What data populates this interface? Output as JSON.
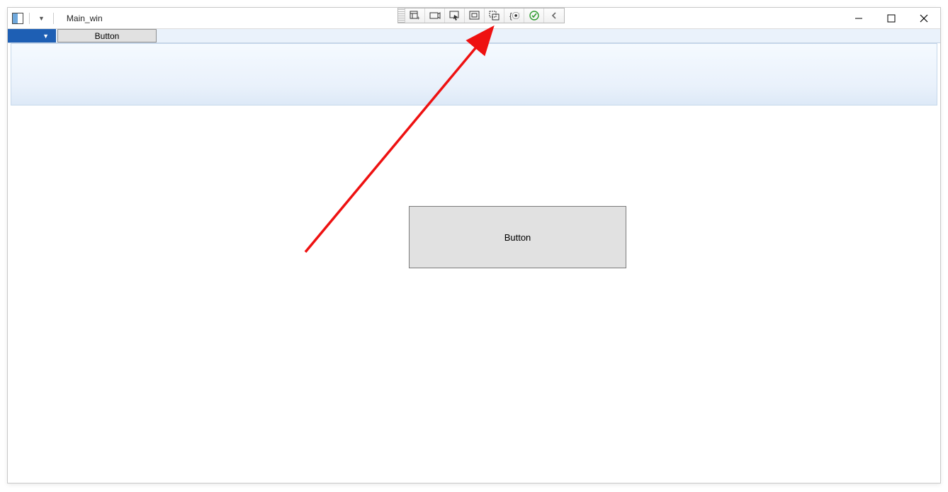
{
  "title": "Main_win",
  "ribbon": {
    "button_label": "Button"
  },
  "canvas": {
    "big_button_label": "Button"
  },
  "toolbar": {
    "icons": [
      "add-layout-icon",
      "camera-icon",
      "pointer-icon",
      "container-icon",
      "group-select-icon",
      "binding-icon",
      "check-ok-icon",
      "collapse-left-icon"
    ]
  }
}
